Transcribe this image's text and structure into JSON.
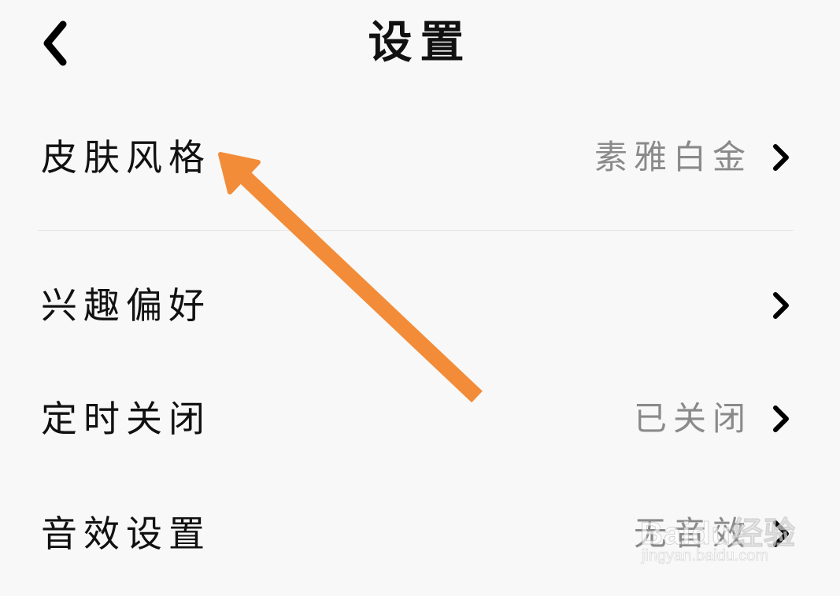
{
  "header": {
    "title": "设置",
    "back_icon": "chevron-left-icon"
  },
  "settings": {
    "items": [
      {
        "label": "皮肤风格",
        "value": "素雅白金",
        "chevron_icon": "chevron-right-icon"
      },
      {
        "label": "兴趣偏好",
        "value": "",
        "chevron_icon": "chevron-right-icon"
      },
      {
        "label": "定时关闭",
        "value": "已关闭",
        "chevron_icon": "chevron-right-icon"
      },
      {
        "label": "音效设置",
        "value": "无音效",
        "chevron_icon": "chevron-right-icon"
      }
    ]
  },
  "annotation": {
    "arrow_color": "#f28c38"
  },
  "watermark": {
    "brand": "Baidu经验",
    "url": "jingyan.baidu.com"
  },
  "colors": {
    "background": "#f8f8f8",
    "label": "#111111",
    "value": "#8a8a8a",
    "divider": "#e4e4e4"
  }
}
